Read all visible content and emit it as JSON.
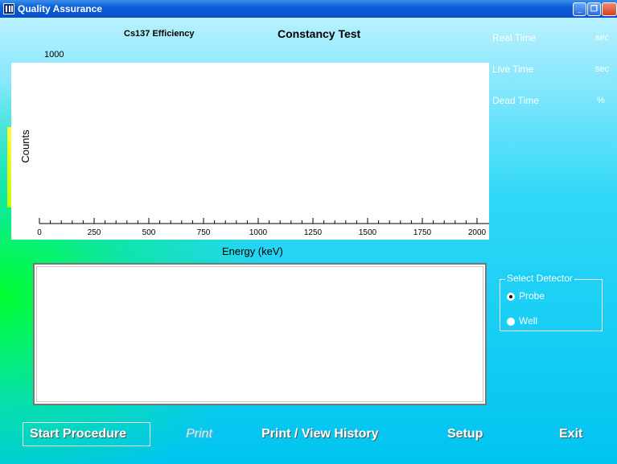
{
  "window": {
    "title": "Quality Assurance"
  },
  "header": {
    "efficiency_label": "Cs137 Efficiency",
    "test_name": "Constancy Test",
    "y_max": "1000"
  },
  "stats": [
    {
      "label": "Real Time",
      "unit": "sec"
    },
    {
      "label": "Live Time",
      "unit": "sec"
    },
    {
      "label": "Dead Time",
      "unit": "%"
    }
  ],
  "chart_data": {
    "type": "line",
    "xlabel": "Energy (keV)",
    "ylabel": "Counts",
    "xlim": [
      0,
      2000
    ],
    "ylim": [
      0,
      1000
    ],
    "x_ticks": [
      "0",
      "250",
      "500",
      "750",
      "1000",
      "1250",
      "1500",
      "1750",
      "2000"
    ],
    "series": []
  },
  "detector": {
    "title": "Select Detector",
    "options": [
      {
        "label": "Probe",
        "selected": true
      },
      {
        "label": "Well",
        "selected": false
      }
    ]
  },
  "buttons": {
    "start": "Start Procedure",
    "print": "Print",
    "history": "Print / View History",
    "setup": "Setup",
    "exit": "Exit"
  }
}
